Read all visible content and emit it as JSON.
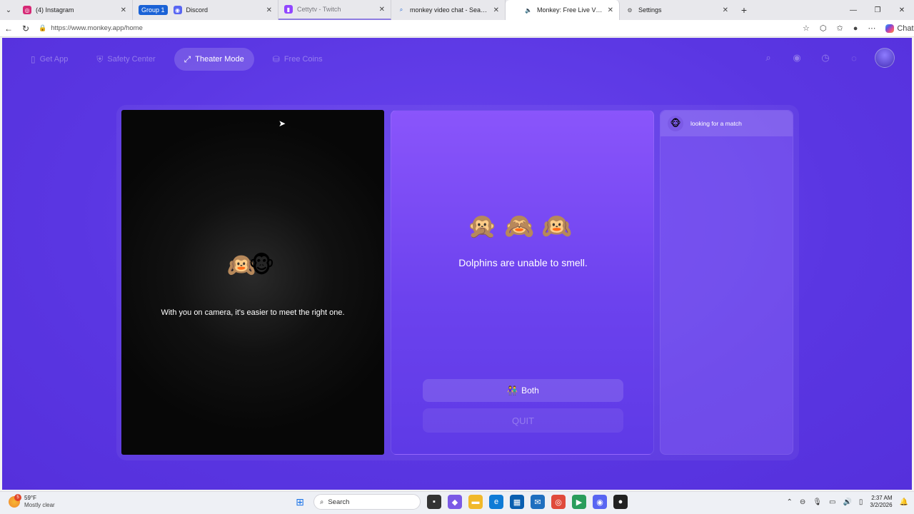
{
  "browser": {
    "tabs": [
      {
        "title": "(4) Instagram",
        "icon": "instagram-icon",
        "color": "#d62976"
      },
      {
        "group": "Group 1",
        "title": "Discord",
        "icon": "discord-icon",
        "color": "#5865f2"
      },
      {
        "title": "Cettytv - Twitch",
        "icon": "twitch-icon",
        "color": "#9146ff"
      },
      {
        "title": "monkey video chat - Search",
        "icon": "search-icon",
        "color": "#1a62d6"
      },
      {
        "title": "Monkey: Free Live Video Chat",
        "icon": "monkey-icon",
        "color": "#f2a34c"
      },
      {
        "title": "Settings",
        "icon": "gear-icon",
        "color": "#555555"
      }
    ],
    "url": "https://www.monkey.app/home",
    "chat_label": "Chat"
  },
  "app": {
    "nav": {
      "get_app": "Get App",
      "safety_center": "Safety Center",
      "theater_mode": "Theater Mode",
      "free_coins": "Free Coins"
    },
    "camera": {
      "emoji": "🙉🐵",
      "message": "With you on camera, it's easier to meet the right one."
    },
    "match_panel": {
      "monkeys": "🙊🙈🙉",
      "fact": "Dolphins are unable to smell.",
      "both_icon": "👫",
      "both_label": "Both",
      "quit_label": "QUIT"
    },
    "sidebar": {
      "status_emoji": "🐵",
      "status": "looking for a match"
    },
    "accent_color": "#5a36e2"
  },
  "taskbar": {
    "weather_badge": "5",
    "temperature": "59°F",
    "condition": "Mostly clear",
    "search_placeholder": "Search",
    "time": "2:37 AM",
    "date": "3/2/2026"
  }
}
